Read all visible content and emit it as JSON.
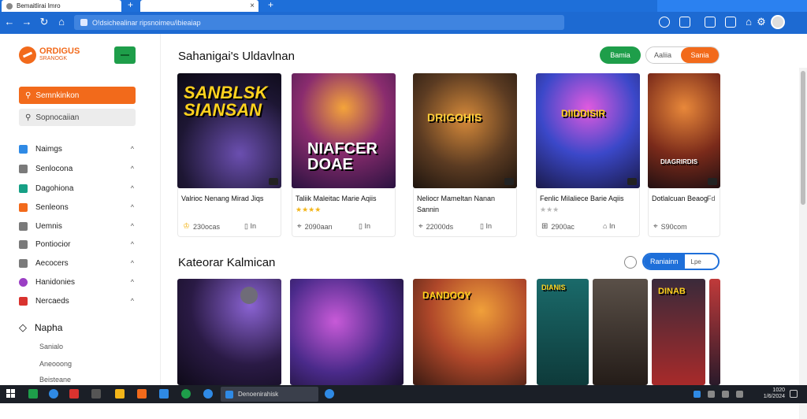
{
  "browser": {
    "tabs": [
      {
        "title": "Bemaitlirai Imro",
        "close": "×"
      }
    ],
    "new_tab": "+",
    "address": "O!dsichealinar ripsnoimeu/ibieaiap",
    "nav": {
      "back": "←",
      "forward": "→",
      "reload": "↻"
    }
  },
  "logo": {
    "name": "ORDIGUS",
    "sub": "SRANOGK"
  },
  "sidebar": {
    "primary_button": "Semnkinkon",
    "secondary_button": "Sopnocaiian",
    "items": [
      {
        "label": "Naimgs",
        "color": "#2f8ae5"
      },
      {
        "label": "Senlocona",
        "color": "#7a7a7a"
      },
      {
        "label": "Dagohiona",
        "color": "#16a085"
      },
      {
        "label": "Senleons",
        "color": "#f26a1b"
      },
      {
        "label": "Uemnis",
        "color": "#7a7a7a"
      },
      {
        "label": "Pontiocior",
        "color": "#7a7a7a"
      },
      {
        "label": "Aecocers",
        "color": "#7a7a7a"
      },
      {
        "label": "Hanidonies",
        "color": "#9b3fc4"
      },
      {
        "label": "Nercaeds",
        "color": "#d9332f"
      }
    ],
    "chevron": "^",
    "section": {
      "title": "Napha",
      "items": [
        "Sanialo",
        "Aneooong",
        "Beisteane"
      ]
    }
  },
  "sections": [
    {
      "title": "Sahanigai's Uldavlnan",
      "buttons": [
        "Bamia",
        "Aaliia",
        "Sania"
      ],
      "cards": [
        {
          "art_title": "SANBLSK SIANSAN",
          "title": "Valrioc Nenang Mirad Jiqs",
          "rating_stars": "",
          "views": "230ocas",
          "extra": "In"
        },
        {
          "art_title": "NIAFCER DOAE",
          "title": "Taliik Maleitac Marie Aqiis",
          "rating_stars": "★★★★",
          "views": "2090aan",
          "extra": "In"
        },
        {
          "art_title": "DRIGOHIS",
          "title": "Neliocr Mameltan Nanan Sannin",
          "rating_stars": "",
          "views": "22000ds",
          "extra": "In"
        },
        {
          "art_title": "DIIDDISIR",
          "title": "Fenlic Milaliece Barie Aqiis",
          "rating_stars": "★★★",
          "views": "2900ac",
          "extra": "In"
        },
        {
          "art_title": "DIAGRIRDIS",
          "title": "Dotlalcuan Beaog",
          "rating_stars": "",
          "views": "S90com",
          "extra": "Fd"
        }
      ]
    },
    {
      "title": "Kateorar Kalmican",
      "buttons": [
        "Raniainn",
        "Lpe"
      ],
      "cards": [
        {
          "art_title": ""
        },
        {
          "art_title": ""
        },
        {
          "art_title": "DANDOOY"
        },
        {
          "art_title": "DIANIS"
        },
        {
          "art_title": "DINAB"
        }
      ]
    }
  ],
  "taskbar": {
    "active_window": "Denoenirahisk",
    "time": "1020",
    "date": "1/6/2024"
  }
}
